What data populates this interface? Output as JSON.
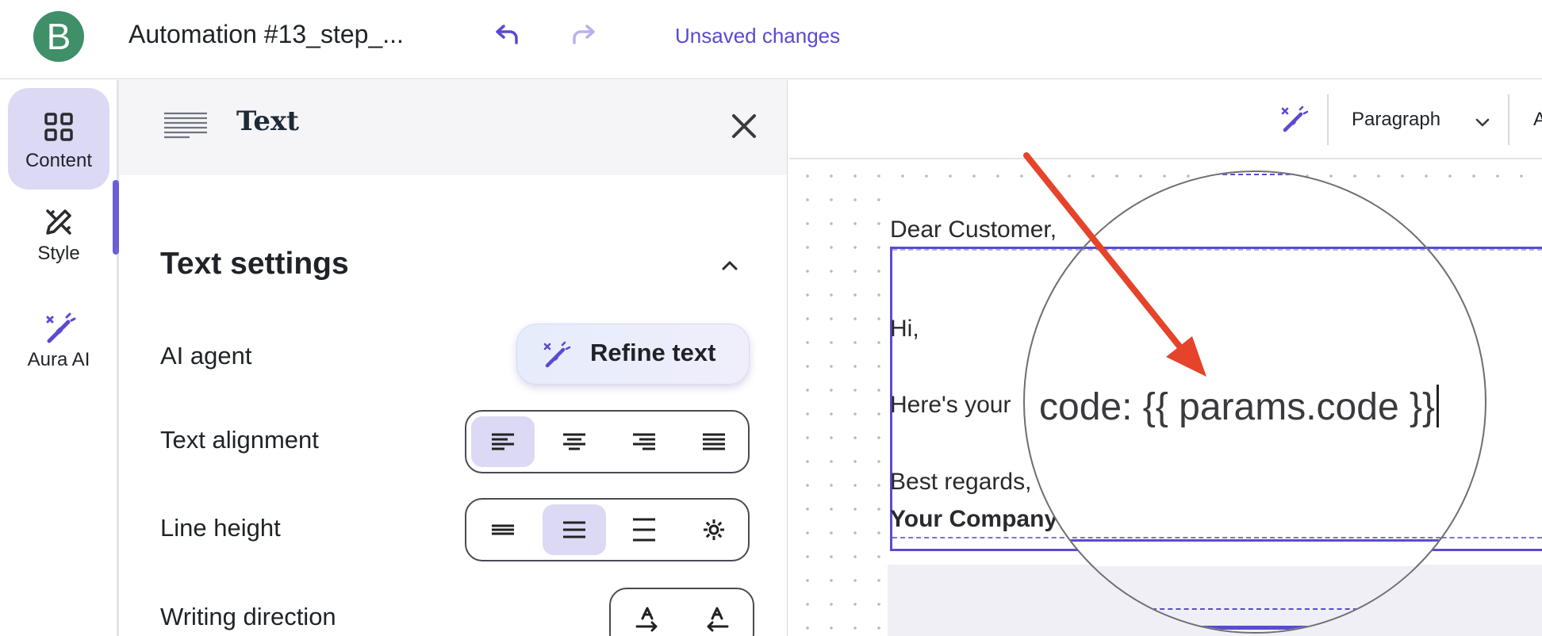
{
  "app": {
    "logo_letter": "B",
    "title": "Automation #13_step_...",
    "status": "Unsaved changes",
    "accent_color": "#5a4ad1",
    "brand_color": "#3f8f69"
  },
  "toolbar_icons": {
    "undo": "undo-icon",
    "redo": "redo-icon"
  },
  "rail": {
    "items": [
      {
        "label": "Content",
        "icon": "grid-icon",
        "active": true
      },
      {
        "label": "Style",
        "icon": "pen-ruler-icon",
        "active": false
      },
      {
        "label": "Aura AI",
        "icon": "magic-wand-icon",
        "active": false
      }
    ]
  },
  "panel": {
    "title": "Text",
    "section_title": "Text settings",
    "rows": {
      "ai_agent": {
        "label": "AI agent",
        "button": "Refine text"
      },
      "alignment": {
        "label": "Text alignment",
        "options": [
          "left",
          "center",
          "right",
          "justify"
        ],
        "selected": "left"
      },
      "line_height": {
        "label": "Line height",
        "options": [
          "compact",
          "normal",
          "loose",
          "custom"
        ],
        "selected": "normal"
      },
      "direction": {
        "label": "Writing direction",
        "options": [
          "ltr",
          "rtl"
        ]
      }
    }
  },
  "editor": {
    "toolbar": {
      "format": "Paragraph",
      "partial_label": "A"
    },
    "email": {
      "greeting": "Dear Customer,",
      "hi": "Hi,",
      "code_line_visible": "Here's your",
      "regards": "Best regards,",
      "company": "Your Company"
    },
    "magnifier_text": "code: {{ params.code }}"
  }
}
